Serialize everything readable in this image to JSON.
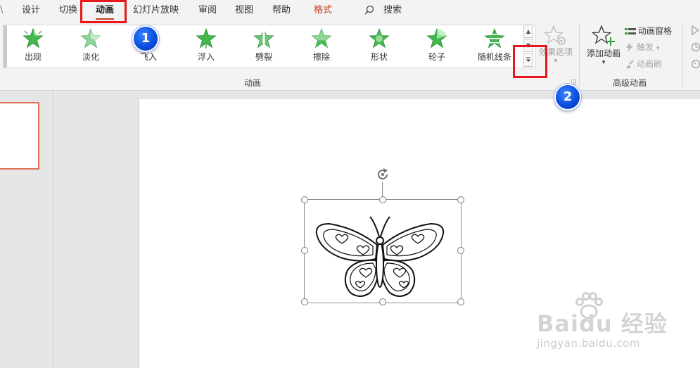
{
  "menu": {
    "partial_left": "\\",
    "tabs": [
      {
        "label": "设计"
      },
      {
        "label": "切换"
      },
      {
        "label": "动画"
      },
      {
        "label": "幻灯片放映"
      },
      {
        "label": "审阅"
      },
      {
        "label": "视图"
      },
      {
        "label": "帮助"
      },
      {
        "label": "格式"
      }
    ],
    "active_tab": "动画",
    "search_label": "搜索",
    "accent_color": "#c43e1c"
  },
  "ribbon": {
    "animations": [
      {
        "label": "出现",
        "icon": "star-appear-icon"
      },
      {
        "label": "淡化",
        "icon": "star-fade-icon"
      },
      {
        "label": "飞入",
        "icon": "star-fly-in-icon"
      },
      {
        "label": "浮入",
        "icon": "star-float-in-icon"
      },
      {
        "label": "劈裂",
        "icon": "star-split-icon"
      },
      {
        "label": "擦除",
        "icon": "star-wipe-icon"
      },
      {
        "label": "形状",
        "icon": "star-shape-icon"
      },
      {
        "label": "轮子",
        "icon": "star-wheel-icon"
      },
      {
        "label": "随机线条",
        "icon": "star-random-bars-icon"
      }
    ],
    "effect_options": {
      "label": "效果选项"
    },
    "group_animation_label": "动画",
    "add_animation": {
      "label": "添加动画"
    },
    "animation_pane_label": "动画窗格",
    "trigger_label": "触发",
    "animation_painter_label": "动画刷",
    "group_advanced_label": "高级动画",
    "star_color": "#3dbb4f"
  },
  "annotations": {
    "badge_1": "1",
    "badge_2": "2",
    "highlight_color": "#e8161b",
    "badge_color": "#0b4ee0"
  },
  "watermark": {
    "brand": "Baidu 经验",
    "url": "jingyan.baidu.com"
  }
}
